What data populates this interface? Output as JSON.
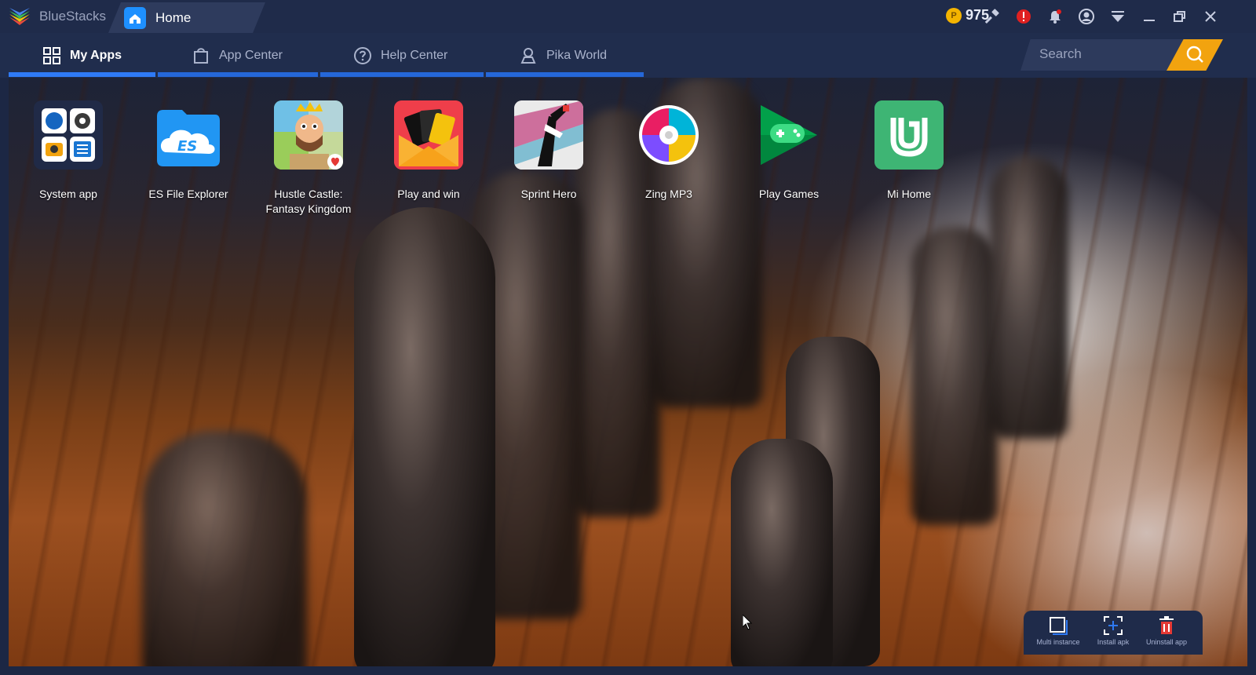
{
  "window": {
    "brand": "BlueStacks",
    "active_tab": "Home",
    "coins": "975",
    "icons": [
      "hammer-icon",
      "alert-icon",
      "notification-bell-icon",
      "account-icon",
      "menu-dropdown-icon",
      "minimize-icon",
      "restore-icon",
      "close-icon"
    ]
  },
  "nav": {
    "tabs": [
      {
        "label": "My Apps",
        "icon": "grid-icon",
        "active": true
      },
      {
        "label": "App Center",
        "icon": "shopping-bag-icon",
        "active": false
      },
      {
        "label": "Help Center",
        "icon": "question-circle-icon",
        "active": false
      },
      {
        "label": "Pika World",
        "icon": "map-pin-icon",
        "active": false
      }
    ],
    "search": {
      "placeholder": "Search"
    }
  },
  "apps": [
    {
      "label": "System app"
    },
    {
      "label": "ES File Explorer"
    },
    {
      "label": "Hustle Castle:\nFantasy Kingdom"
    },
    {
      "label": "Play and win"
    },
    {
      "label": "Sprint Hero"
    },
    {
      "label": "Zing MP3"
    },
    {
      "label": "Play Games"
    },
    {
      "label": "Mi Home"
    }
  ],
  "toolbar": {
    "multi_instance": "Multi instance",
    "install_apk": "Install apk",
    "uninstall_app": "Uninstall app"
  },
  "colors": {
    "titlebar": "#1f2b4a",
    "active_tab_underline": "#2f7af5",
    "search_button": "#f2a30f",
    "coin": "#f4b400"
  }
}
